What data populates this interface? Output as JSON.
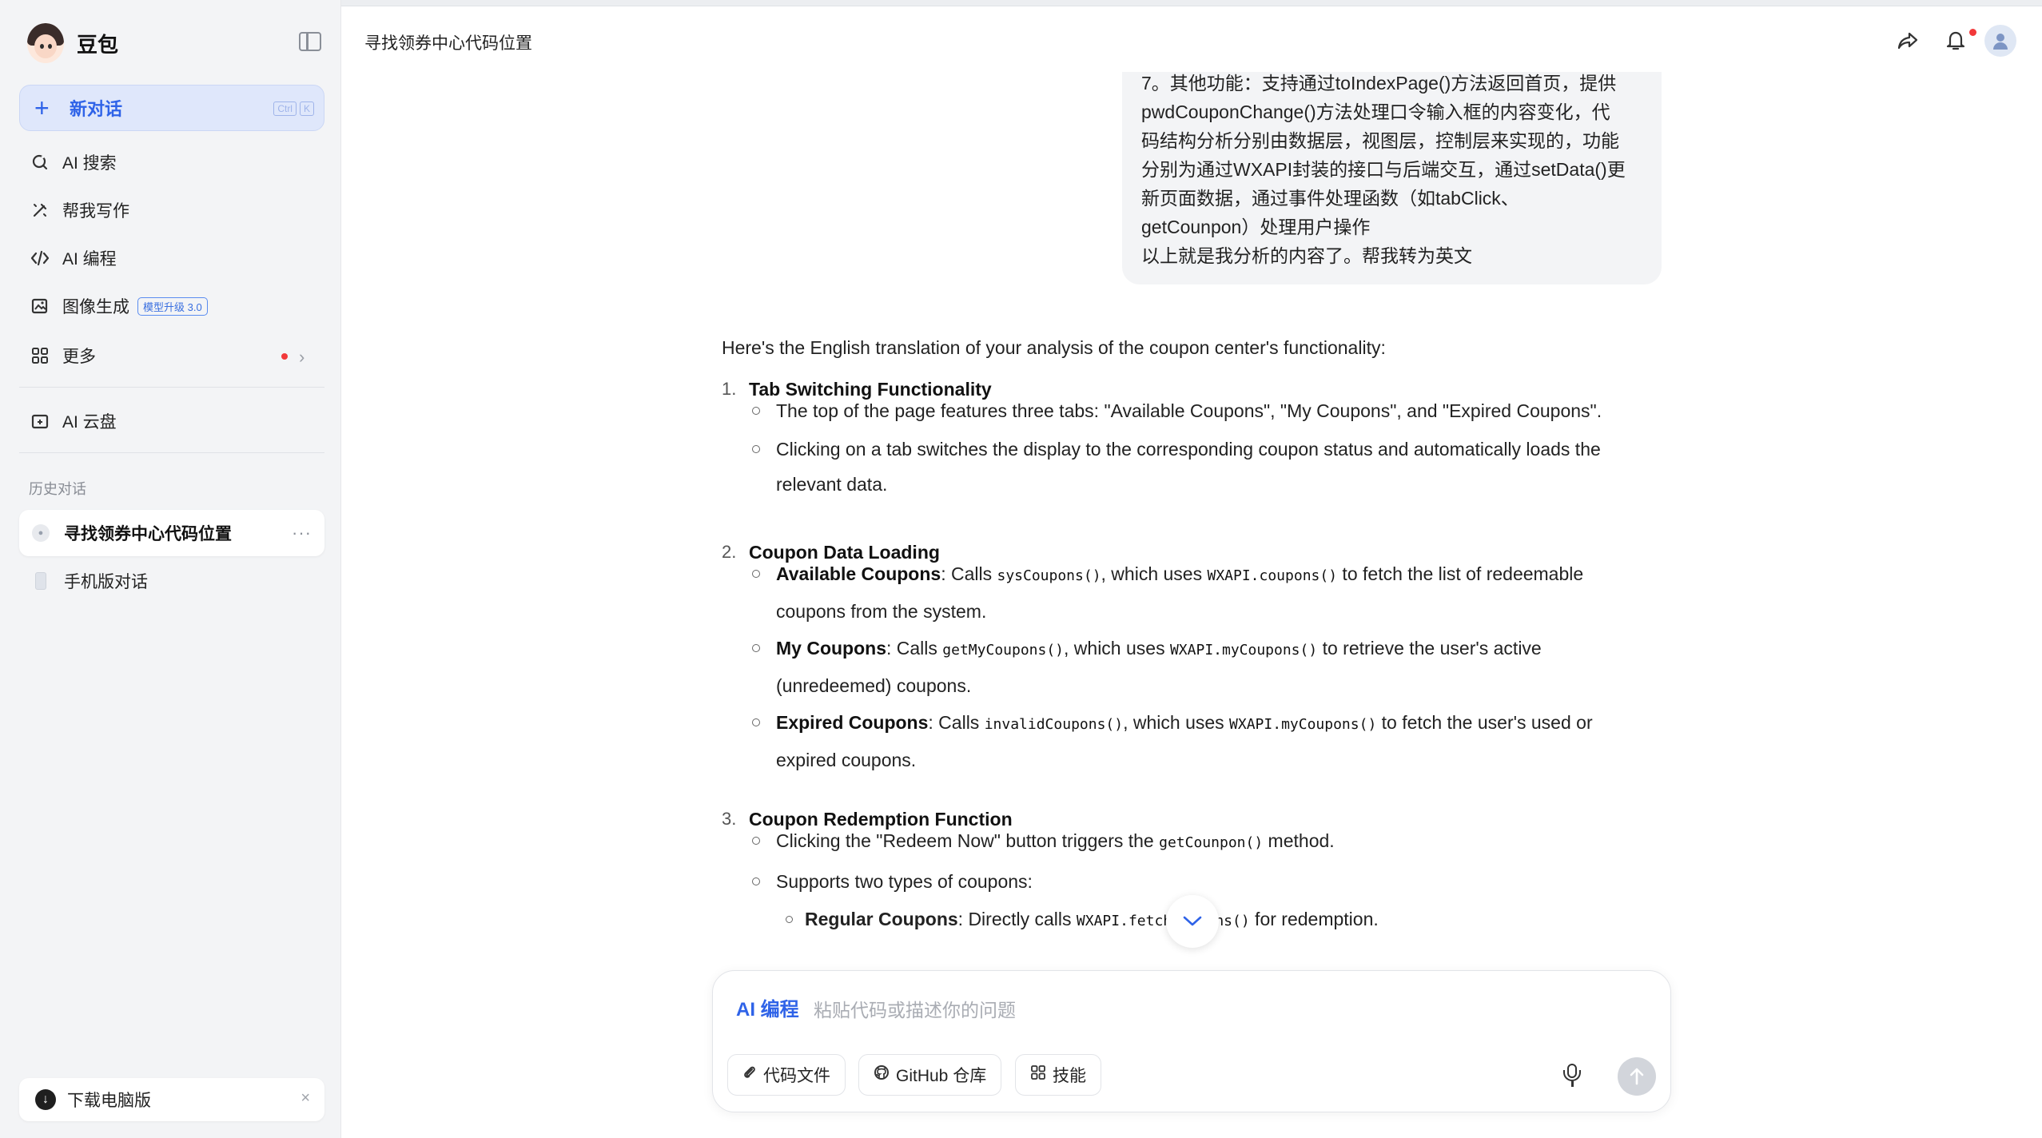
{
  "app": {
    "name": "豆包",
    "conversation_title": "寻找领券中心代码位置"
  },
  "sidebar": {
    "new_chat": {
      "label": "新对话",
      "shortcut": [
        "Ctrl",
        "K"
      ]
    },
    "nav": [
      {
        "label": "AI 搜索",
        "icon": "search-refresh-icon"
      },
      {
        "label": "帮我写作",
        "icon": "pen-icon"
      },
      {
        "label": "AI 编程",
        "icon": "code-icon"
      },
      {
        "label": "图像生成",
        "icon": "image-icon",
        "badge": "模型升级 3.0"
      },
      {
        "label": "更多",
        "icon": "grid-icon",
        "has_dot": true
      },
      {
        "label": "AI 云盘",
        "icon": "cloud-drive-icon"
      }
    ],
    "history_label": "历史对话",
    "history": [
      {
        "label": "寻找领券中心代码位置",
        "active": true
      },
      {
        "label": "手机版对话",
        "active": false
      }
    ],
    "download": {
      "label": "下载电脑版"
    }
  },
  "user_message": {
    "lines": [
      "7。其他功能：支持通过toIndexPage()方法返回首页，提供",
      "pwdCouponChange()方法处理口令输入框的内容变化，代",
      "码结构分析分别由数据层，视图层，控制层来实现的，功能",
      "分别为通过WXAPI封装的接口与后端交互，通过setData()更",
      "新页面数据，通过事件处理函数（如tabClick、",
      "getCounpon）处理用户操作",
      "以上就是我分析的内容了。帮我转为英文"
    ]
  },
  "assistant": {
    "intro": "Here's the English translation of your analysis of the coupon center's functionality:",
    "sections": [
      {
        "num": "1.",
        "title": "Tab Switching Functionality",
        "bullets": [
          {
            "text": "The top of the page features three tabs: \"Available Coupons\", \"My Coupons\", and \"Expired Coupons\"."
          },
          {
            "text1": "Clicking on a tab switches the display to the corresponding coupon status and automatically loads the",
            "text2": "relevant data."
          }
        ]
      },
      {
        "num": "2.",
        "title": "Coupon Data Loading",
        "bullets": [
          {
            "bold": "Available Coupons",
            "pre": ": Calls ",
            "code1": "sysCoupons()",
            "mid": ", which uses ",
            "code2": "WXAPI.coupons()",
            "post": " to fetch the list of redeemable",
            "cont": "coupons from the system."
          },
          {
            "bold": "My Coupons",
            "pre": ": Calls ",
            "code1": "getMyCoupons()",
            "mid": ", which uses ",
            "code2": "WXAPI.myCoupons()",
            "post": " to retrieve the user's active",
            "cont": "(unredeemed) coupons."
          },
          {
            "bold": "Expired Coupons",
            "pre": ": Calls ",
            "code1": "invalidCoupons()",
            "mid": ", which uses ",
            "code2": "WXAPI.myCoupons()",
            "post": " to fetch the user's used or",
            "cont": "expired coupons."
          }
        ]
      },
      {
        "num": "3.",
        "title": "Coupon Redemption Function",
        "bullets": [
          {
            "pre": "Clicking the \"Redeem Now\" button triggers the ",
            "code1": "getCounpon()",
            "post": " method."
          },
          {
            "text": "Supports two types of coupons:"
          }
        ],
        "sub": {
          "bold": "Regular Coupons",
          "pre": ": Directly calls ",
          "code1": "WXAPI.fetchCoupons()",
          "post": " for redemption."
        }
      }
    ]
  },
  "input": {
    "mode": "AI 编程",
    "placeholder": "粘贴代码或描述你的问题",
    "chips": [
      {
        "label": "代码文件",
        "icon": "paperclip-icon"
      },
      {
        "label": "GitHub 仓库",
        "icon": "github-icon"
      },
      {
        "label": "技能",
        "icon": "grid-icon"
      }
    ]
  },
  "colors": {
    "accent": "#2f63e8",
    "sidebar_bg": "#f3f4f6",
    "notification_dot": "#f2393a"
  }
}
